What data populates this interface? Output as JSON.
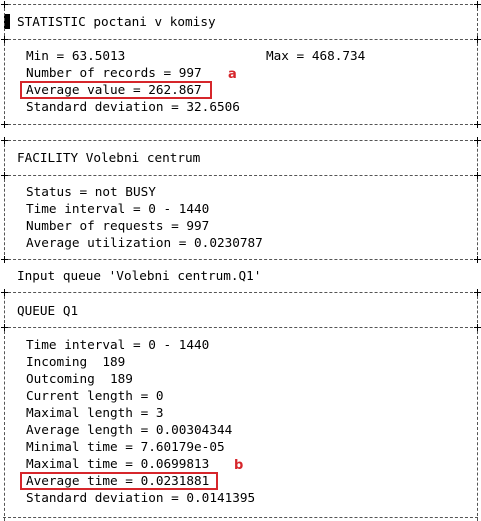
{
  "statistic": {
    "title": "STATISTIC poctani v komisy",
    "min": "Min = 63.5013",
    "max": "Max = 468.734",
    "records": "Number of records = 997",
    "average": "Average value = 262.867",
    "stddev": "Standard deviation = 32.6506"
  },
  "facility": {
    "title": "FACILITY Volebni centrum",
    "status": "Status = not BUSY",
    "interval": "Time interval = 0 - 1440",
    "requests": "Number of requests = 997",
    "utilization": "Average utilization = 0.0230787"
  },
  "input_queue_label": "Input queue 'Volebni centrum.Q1'",
  "queue": {
    "title": "QUEUE Q1",
    "interval": "Time interval = 0 - 1440",
    "incoming": "Incoming  189",
    "outcoming": "Outcoming  189",
    "current_length": "Current length = 0",
    "maximal_length": "Maximal length = 3",
    "average_length": "Average length = 0.00304344",
    "minimal_time": "Minimal time = 7.60179e-05",
    "maximal_time": "Maximal time = 0.0699813",
    "average_time": "Average time = 0.0231881",
    "stddev": "Standard deviation = 0.0141395"
  },
  "annotations": {
    "a": "a",
    "b": "b",
    "highlight_color": "#d6262b"
  }
}
